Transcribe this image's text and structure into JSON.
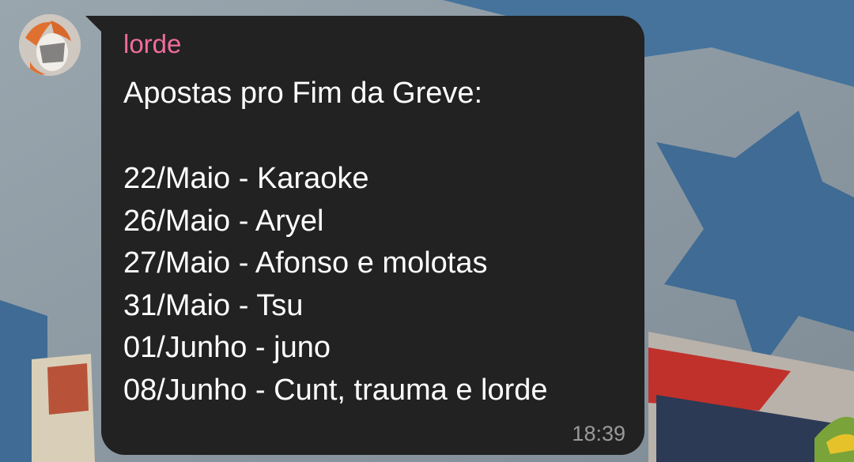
{
  "message": {
    "sender": "lorde",
    "title": "Apostas pro Fim da Greve:",
    "lines": [
      "22/Maio - Karaoke",
      "26/Maio - Aryel",
      "27/Maio - Afonso e molotas",
      "31/Maio - Tsu",
      "01/Junho - juno",
      "08/Junho - Cunt, trauma e lorde"
    ],
    "time": "18:39"
  },
  "colors": {
    "bubble": "#222222",
    "sender_name": "#f06c9c",
    "message_text": "#ffffff",
    "timestamp": "#9a9a9a",
    "wallpaper_star": "#3f6b94"
  },
  "icons": {
    "avatar": "user-avatar-image"
  }
}
